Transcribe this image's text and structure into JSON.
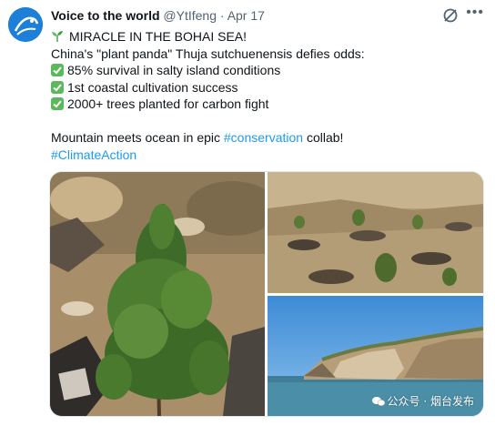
{
  "tweet": {
    "author_name": "Voice to the world",
    "handle": "@YtIfeng",
    "separator": "·",
    "date": "Apr 17",
    "more_label": "•••",
    "lines": {
      "headline": "MIRACLE IN THE BOHAI SEA!",
      "intro": "China's \"plant panda\" Thuja sutchuenensis defies odds:",
      "point1": "85% survival in salty island conditions",
      "point2": "1st coastal cultivation success",
      "point3": "2000+ trees planted for carbon fight",
      "closing_prefix": "Mountain meets ocean in epic ",
      "closing_hashtag": "#conservation",
      "closing_suffix": " collab!",
      "hashtag2": "#ClimateAction"
    }
  },
  "media": {
    "watermark": "公众号 · 烟台发布"
  },
  "colors": {
    "link": "#1d9bf0",
    "check": "#5cb85c",
    "avatar": "#1d7fd8"
  },
  "icons": [
    "sprout-icon",
    "check-mark-icon",
    "grok-icon",
    "more-icon"
  ]
}
